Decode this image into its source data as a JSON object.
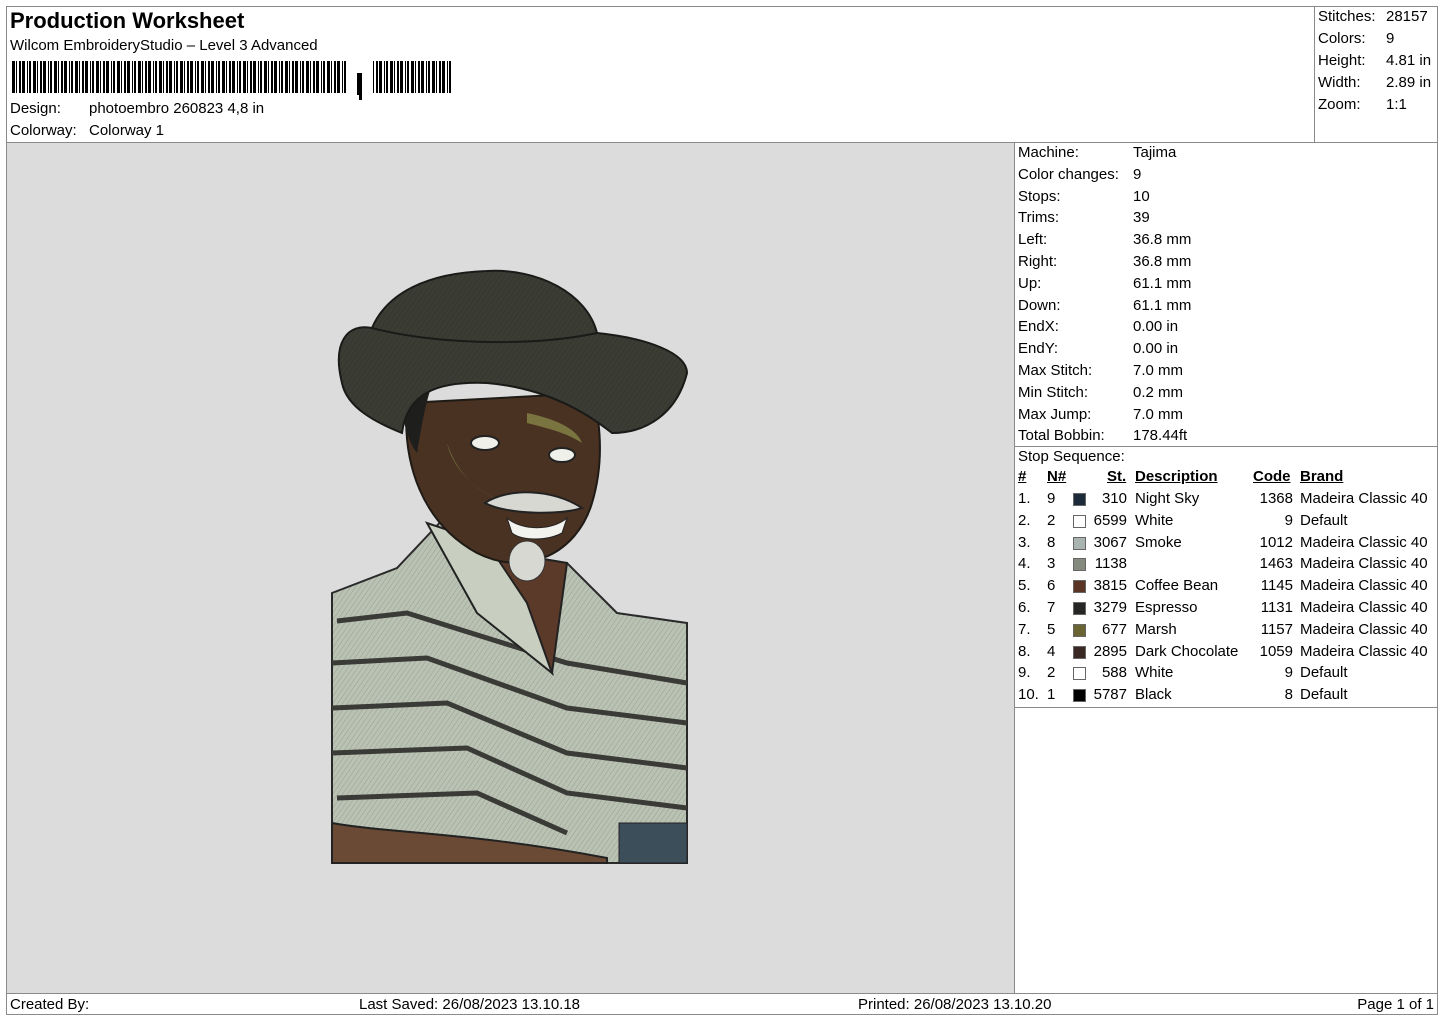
{
  "header": {
    "title": "Production Worksheet",
    "software": "Wilcom EmbroideryStudio – Level 3 Advanced",
    "design_label": "Design:",
    "design_value": "photoembro 260823 4,8 in",
    "colorway_label": "Colorway:",
    "colorway_value": "Colorway 1"
  },
  "summary": [
    {
      "label": "Stitches:",
      "value": "28157"
    },
    {
      "label": "Colors:",
      "value": "9"
    },
    {
      "label": "Height:",
      "value": "4.81 in"
    },
    {
      "label": "Width:",
      "value": "2.89 in"
    },
    {
      "label": "Zoom:",
      "value": "1:1"
    }
  ],
  "machine_info": [
    {
      "label": "Machine:",
      "value": "Tajima"
    },
    {
      "label": "Color changes:",
      "value": "9"
    },
    {
      "label": "Stops:",
      "value": "10"
    },
    {
      "label": "Trims:",
      "value": "39"
    },
    {
      "label": "Left:",
      "value": "36.8 mm"
    },
    {
      "label": "Right:",
      "value": "36.8 mm"
    },
    {
      "label": "Up:",
      "value": "61.1 mm"
    },
    {
      "label": "Down:",
      "value": "61.1 mm"
    },
    {
      "label": "EndX:",
      "value": "0.00 in"
    },
    {
      "label": "EndY:",
      "value": "0.00 in"
    },
    {
      "label": "Max Stitch:",
      "value": "7.0 mm"
    },
    {
      "label": "Min Stitch:",
      "value": "0.2 mm"
    },
    {
      "label": "Max Jump:",
      "value": "7.0 mm"
    },
    {
      "label": "Total Bobbin:",
      "value": "178.44ft"
    }
  ],
  "stop_sequence": {
    "title": "Stop Sequence:",
    "columns": [
      "#",
      "N#",
      "St.",
      "Description",
      "Code",
      "Brand"
    ],
    "rows": [
      {
        "idx": "1.",
        "n": "9",
        "color": "#1c2a3a",
        "st": "310",
        "desc": "Night Sky",
        "code": "1368",
        "brand": "Madeira Classic 40"
      },
      {
        "idx": "2.",
        "n": "2",
        "color": "#ffffff",
        "st": "6599",
        "desc": "White",
        "code": "9",
        "brand": "Default"
      },
      {
        "idx": "3.",
        "n": "8",
        "color": "#a9b3b0",
        "st": "3067",
        "desc": "Smoke",
        "code": "1012",
        "brand": "Madeira Classic 40"
      },
      {
        "idx": "4.",
        "n": "3",
        "color": "#848b7e",
        "st": "1138",
        "desc": "",
        "code": "1463",
        "brand": "Madeira Classic 40"
      },
      {
        "idx": "5.",
        "n": "6",
        "color": "#5a3424",
        "st": "3815",
        "desc": "Coffee Bean",
        "code": "1145",
        "brand": "Madeira Classic 40"
      },
      {
        "idx": "6.",
        "n": "7",
        "color": "#262624",
        "st": "3279",
        "desc": "Espresso",
        "code": "1131",
        "brand": "Madeira Classic 40"
      },
      {
        "idx": "7.",
        "n": "5",
        "color": "#6a6432",
        "st": "677",
        "desc": "Marsh",
        "code": "1157",
        "brand": "Madeira Classic 40"
      },
      {
        "idx": "8.",
        "n": "4",
        "color": "#3a2824",
        "st": "2895",
        "desc": "Dark Chocolate",
        "code": "1059",
        "brand": "Madeira Classic 40"
      },
      {
        "idx": "9.",
        "n": "2",
        "color": "#ffffff",
        "st": "588",
        "desc": "White",
        "code": "9",
        "brand": "Default"
      },
      {
        "idx": "10.",
        "n": "1",
        "color": "#000000",
        "st": "5787",
        "desc": "Black",
        "code": "8",
        "brand": "Default"
      }
    ]
  },
  "footer": {
    "created_by": "Created By:",
    "last_saved": "Last Saved: 26/08/2023 13.10.18",
    "printed": "Printed: 26/08/2023 13.10.20",
    "page": "Page 1 of 1"
  }
}
